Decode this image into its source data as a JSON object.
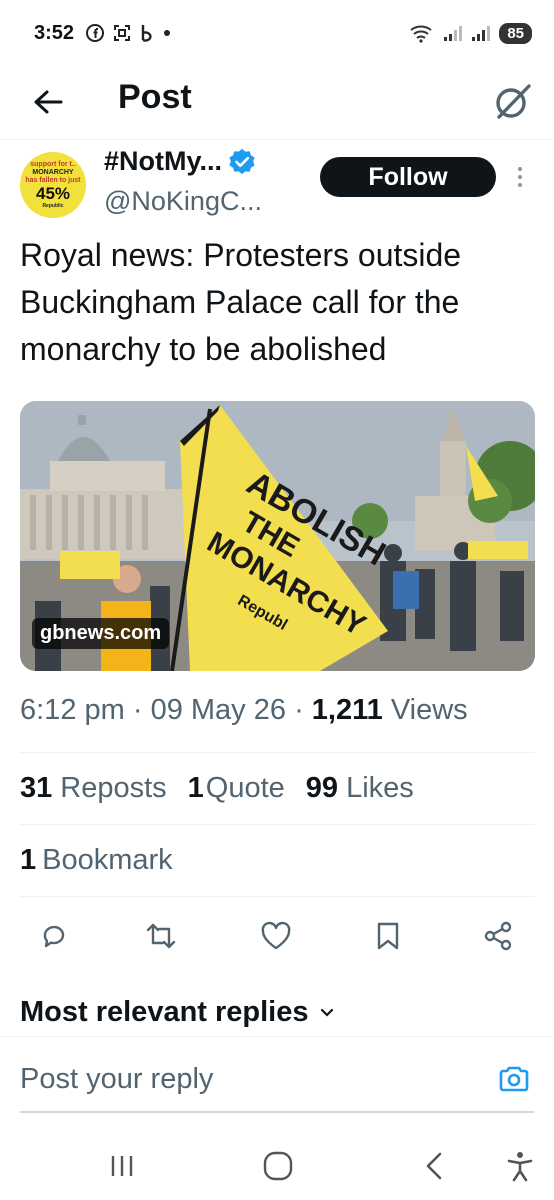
{
  "status_bar": {
    "time": "3:52",
    "battery": "85",
    "icons": [
      "facebook-icon",
      "screenshot-icon",
      "b-app-icon",
      "dot-icon",
      "wifi-icon",
      "signal-icon",
      "signal-icon-2",
      "battery-icon"
    ]
  },
  "header": {
    "title": "Post",
    "back_icon": "arrow-left-icon",
    "grok_icon": "grok-icon"
  },
  "author": {
    "display_name": "#NotMy...",
    "handle": "@NoKingC...",
    "verified": true,
    "follow_label": "Follow",
    "avatar": {
      "line1": "support for t..",
      "line2": "MONARCHY",
      "line3": "has fallen to just",
      "percent": "45%",
      "brand": "Republic"
    }
  },
  "tweet": {
    "text": "Royal news: Protesters outside Buckingham Palace call for the monarchy to be abolished",
    "media": {
      "source_badge": "gbnews.com",
      "flag_text_1": "ABOLISH",
      "flag_text_2": "THE",
      "flag_text_3": "MONARCHY",
      "flag_brand": "Republ"
    },
    "time": "6:12 pm",
    "date": "09 May 26",
    "views_count": "1,211",
    "views_label": "Views",
    "reposts_count": "31",
    "reposts_label": "Reposts",
    "quotes_count": "1",
    "quotes_label": "Quote",
    "likes_count": "99",
    "likes_label": "Likes",
    "bookmarks_count": "1",
    "bookmarks_label": "Bookmark"
  },
  "actions": [
    "reply-icon",
    "repost-icon",
    "like-icon",
    "bookmark-icon",
    "share-icon"
  ],
  "replies": {
    "heading": "Most relevant replies"
  },
  "reply_bar": {
    "placeholder": "Post your reply"
  },
  "colors": {
    "accent": "#1d9bf0",
    "text_primary": "#0f1419",
    "text_secondary": "#536471",
    "flag_yellow": "#f2de4e"
  }
}
